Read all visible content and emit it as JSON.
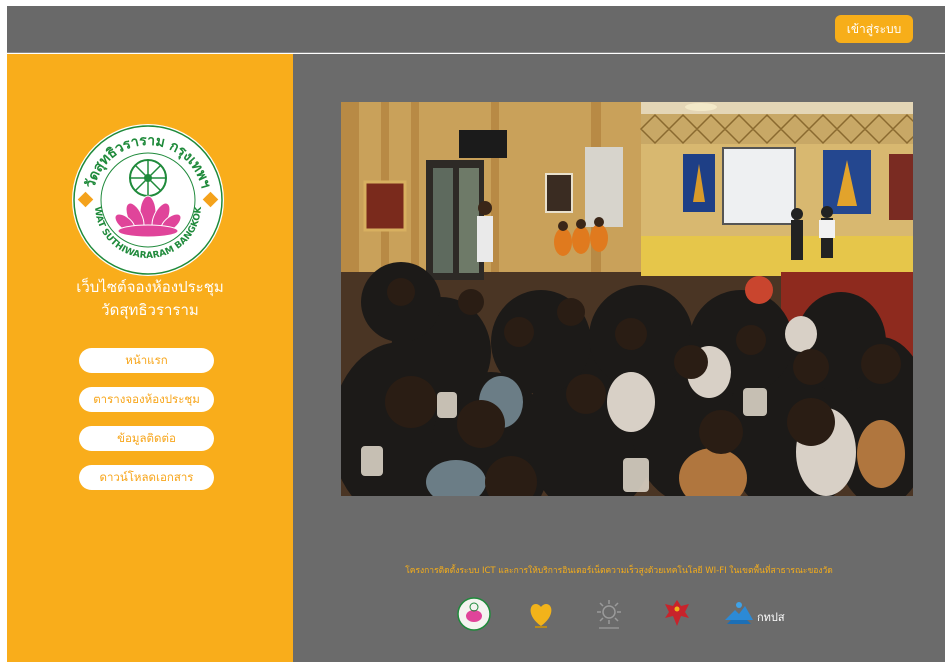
{
  "header": {
    "login_label": "เข้าสู่ระบบ"
  },
  "sidebar": {
    "logo": {
      "text_top": "วัดสุทธิวราราม กรุงเทพฯ",
      "text_bottom": "WAT SUTHIWARARAM BANGKOK"
    },
    "title_line1": "เว็บไซต์จองห้องประชุม",
    "title_line2": "วัดสุทธิวราราม",
    "nav": [
      {
        "label": "หน้าแรก"
      },
      {
        "label": "ตารางจองห้องประชุม"
      },
      {
        "label": "ข้อมูลติดต่อ"
      },
      {
        "label": "ดาวน์โหลดเอกสาร"
      }
    ]
  },
  "main": {
    "footer_text": "โครงการติดตั้งระบบ ICT และการให้บริการอินเตอร์เน็ตความเร็วสูงด้วยเทคโนโลยี WI-FI ในเขตพื้นที่สาธารณะของวัด",
    "sponsors": [
      {
        "icon": "temple-seal-icon"
      },
      {
        "icon": "heart-logo-icon"
      },
      {
        "icon": "sun-emblem-icon"
      },
      {
        "icon": "garuda-icon"
      },
      {
        "icon": "nbtc-logo-icon",
        "label": "กทปส"
      }
    ]
  },
  "colors": {
    "accent": "#f9ad1b",
    "background": "#6b6b6b",
    "topbar": "#696969",
    "logo_green": "#1f8a3b",
    "logo_pink": "#e0449a"
  }
}
